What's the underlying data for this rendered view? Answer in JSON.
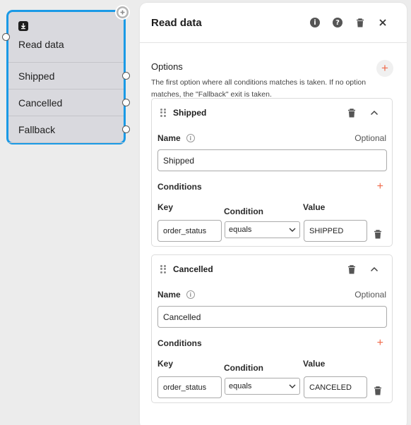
{
  "node": {
    "title": "Read data",
    "exits": [
      {
        "label": "Shipped"
      },
      {
        "label": "Cancelled"
      },
      {
        "label": "Fallback"
      }
    ]
  },
  "panel": {
    "title": "Read data",
    "header_icons": [
      "info-icon",
      "help-icon",
      "trash-icon",
      "close-icon"
    ],
    "options_label": "Options",
    "options_desc": "The first option where all conditions matches is taken. If no option matches, the \"Fallback\" exit is taken.",
    "options": [
      {
        "title": "Shipped",
        "name_label": "Name",
        "optional_label": "Optional",
        "name_value": "Shipped",
        "conditions_label": "Conditions",
        "key_label": "Key",
        "condition_label": "Condition",
        "value_label": "Value",
        "key_value": "order_status",
        "condition_value": "equals",
        "value_value": "SHIPPED"
      },
      {
        "title": "Cancelled",
        "name_label": "Name",
        "optional_label": "Optional",
        "name_value": "Cancelled",
        "conditions_label": "Conditions",
        "key_label": "Key",
        "condition_label": "Condition",
        "value_label": "Value",
        "key_value": "order_status",
        "condition_value": "equals",
        "value_value": "CANCELED"
      }
    ]
  },
  "colors": {
    "node_border": "#1a9ae6",
    "accent": "#f06a4a"
  }
}
